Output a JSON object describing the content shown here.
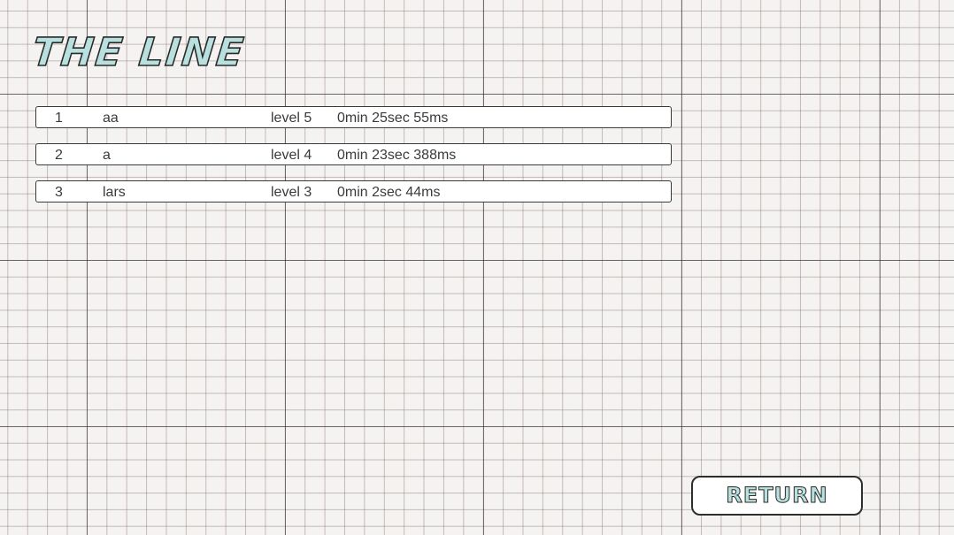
{
  "title": "THE LINE",
  "scores": [
    {
      "rank": "1",
      "name": "aa",
      "level": "level 5",
      "time": "0min 25sec 55ms"
    },
    {
      "rank": "2",
      "name": "a",
      "level": "level 4",
      "time": "0min 23sec 388ms"
    },
    {
      "rank": "3",
      "name": "lars",
      "level": "level 3",
      "time": "0min 2sec 44ms"
    }
  ],
  "return_button": {
    "label": "RETURN"
  },
  "colors": {
    "title_fill": "#b8e0de",
    "outline": "#2a2a2a",
    "paper": "#f4f3f1"
  }
}
